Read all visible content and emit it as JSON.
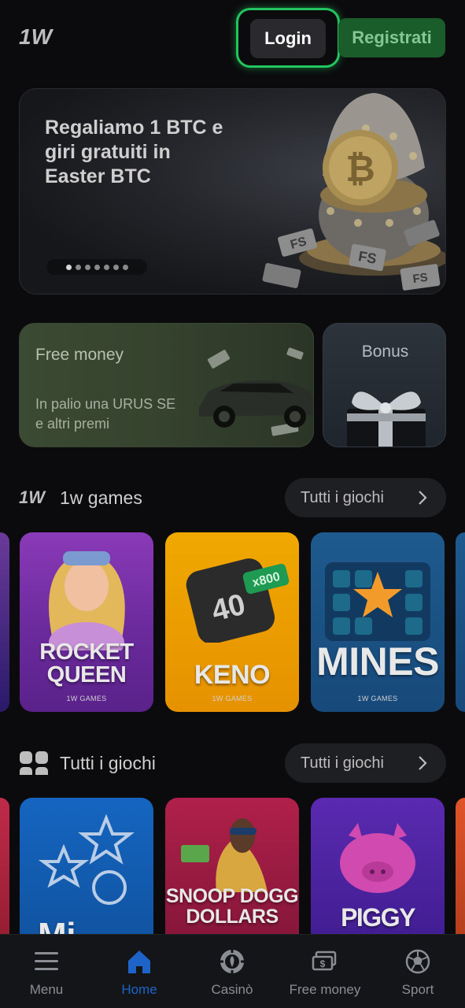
{
  "header": {
    "logo_text": "1W",
    "login_label": "Login",
    "register_label": "Registrati"
  },
  "hero": {
    "title": "Regaliamo 1 BTC e giri gratuiti in Easter BTC",
    "slide_count": 7,
    "active_slide": 1,
    "badge_text": "FS"
  },
  "promos": {
    "free_money": {
      "title": "Free money",
      "subtitle": "In palio una URUS SE e altri premi"
    },
    "bonus": {
      "title": "Bonus"
    }
  },
  "section_1w_games": {
    "title": "1w games",
    "see_all_label": "Tutti i giochi",
    "games": [
      {
        "name": "ROCKET QUEEN",
        "brand": "1W GAMES"
      },
      {
        "name": "KENO",
        "brand": "1W GAMES",
        "badge": "x800",
        "dice": "40"
      },
      {
        "name": "MINES",
        "brand": "1W GAMES"
      }
    ]
  },
  "section_all_games": {
    "title": "Tutti i giochi",
    "see_all_label": "Tutti i giochi",
    "games": [
      {
        "name": "Mi"
      },
      {
        "name": "SNOOP DOGG DOLLARS"
      },
      {
        "name": "PIGGY BANK"
      }
    ]
  },
  "nav": {
    "items": [
      {
        "label": "Menu",
        "icon": "menu-icon"
      },
      {
        "label": "Home",
        "icon": "home-icon",
        "active": true
      },
      {
        "label": "Casinò",
        "icon": "casino-chip-icon"
      },
      {
        "label": "Free money",
        "icon": "money-icon"
      },
      {
        "label": "Sport",
        "icon": "soccer-ball-icon"
      }
    ]
  },
  "colors": {
    "background": "#0b0b0d",
    "register_green": "#1a5c2a",
    "login_highlight": "#22c55e",
    "active_nav": "#1e64c8"
  }
}
